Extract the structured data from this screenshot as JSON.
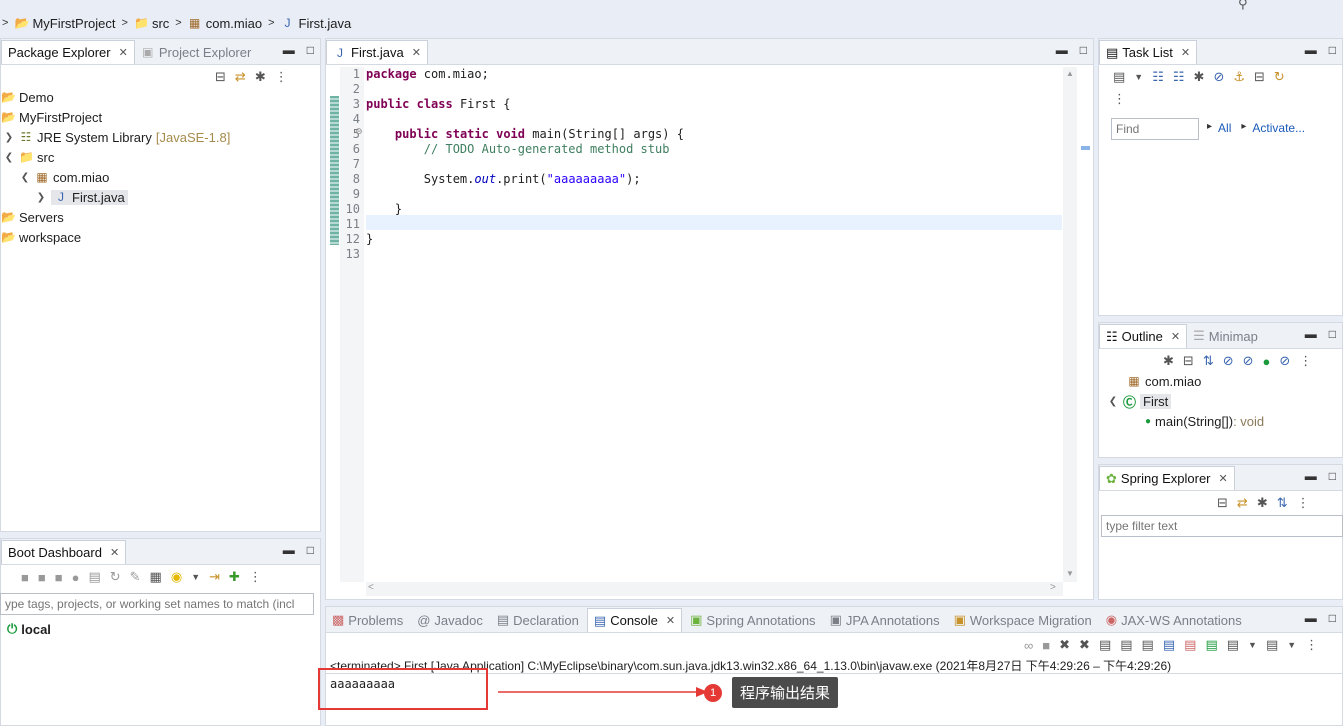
{
  "breadcrumb": {
    "project": "MyFirstProject",
    "folder": "src",
    "package": "com.miao",
    "file": "First.java"
  },
  "package_explorer": {
    "tab_active": "Package Explorer",
    "tab_inactive": "Project Explorer",
    "tree": {
      "demo": "Demo",
      "project": "MyFirstProject",
      "jre": "JRE System Library",
      "jre_version": "[JavaSE-1.8]",
      "src": "src",
      "package": "com.miao",
      "file": "First.java",
      "servers": "Servers",
      "workspace": "workspace"
    }
  },
  "boot_dashboard": {
    "title": "Boot Dashboard",
    "filter_placeholder": "ype tags, projects, or working set names to match (incl",
    "local": "local"
  },
  "editor": {
    "tab": "First.java",
    "line_numbers": [
      "1",
      "2",
      "3",
      "4",
      "5",
      "6",
      "7",
      "8",
      "9",
      "10",
      "11",
      "12",
      "13"
    ],
    "code": {
      "l1_kw": "package",
      "l1_rest": " com.miao;",
      "l3_kw1": "public",
      "l3_kw2": "class",
      "l3_rest": " First {",
      "l5_kw1": "public",
      "l5_kw2": "static",
      "l5_kw3": "void",
      "l5_rest": " main(String[] args) {",
      "l6_comment": "// TODO Auto-generated method stub",
      "l8_pre": "System.",
      "l8_field": "out",
      "l8_mid": ".print(",
      "l8_string": "\"aaaaaaaaa\"",
      "l8_post": ");",
      "l10": "}",
      "l12": "}"
    }
  },
  "task_list": {
    "title": "Task List",
    "find_placeholder": "Find",
    "all": "All",
    "activate": "Activate..."
  },
  "outline": {
    "tab_active": "Outline",
    "tab_inactive": "Minimap",
    "package": "com.miao",
    "class": "First",
    "method": "main(String[])",
    "method_type": " : void"
  },
  "spring_explorer": {
    "title": "Spring Explorer",
    "filter_placeholder": "type filter text"
  },
  "bottom_tabs": {
    "problems": "Problems",
    "javadoc": "Javadoc",
    "declaration": "Declaration",
    "console": "Console",
    "spring_annotations": "Spring Annotations",
    "jpa_annotations": "JPA Annotations",
    "workspace_migration": "Workspace Migration",
    "jaxws_annotations": "JAX-WS Annotations"
  },
  "console": {
    "status": "<terminated> First [Java Application] C:\\MyEclipse\\binary\\com.sun.java.jdk13.win32.x86_64_1.13.0\\bin\\javaw.exe  (2021年8月27日 下午4:29:26 – 下午4:29:26)",
    "output": "aaaaaaaaa"
  },
  "annotation": {
    "badge": "1",
    "label": "程序输出结果",
    "color": "#e53935"
  }
}
